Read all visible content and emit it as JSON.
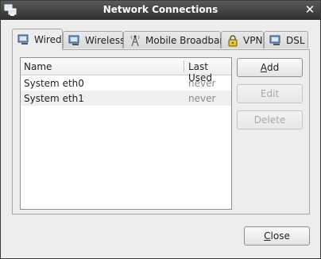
{
  "window": {
    "title": "Network Connections",
    "icon": "network-connections-icon",
    "close_icon": "close-icon"
  },
  "tabs": [
    {
      "label": "Wired",
      "icon": "wired-icon",
      "active": true
    },
    {
      "label": "Wireless",
      "icon": "wireless-icon",
      "active": false
    },
    {
      "label": "Mobile Broadband",
      "icon": "mobile-broadband-icon",
      "active": false
    },
    {
      "label": "VPN",
      "icon": "vpn-lock-icon",
      "active": false
    },
    {
      "label": "DSL",
      "icon": "dsl-icon",
      "active": false
    }
  ],
  "table": {
    "columns": [
      "Name",
      "Last Used"
    ],
    "rows": [
      {
        "name": "System eth0",
        "last_used": "never"
      },
      {
        "name": "System eth1",
        "last_used": "never"
      }
    ]
  },
  "buttons": {
    "add": {
      "mnemonic": "A",
      "rest": "dd",
      "enabled": true
    },
    "edit": {
      "label": "Edit",
      "enabled": false
    },
    "delete": {
      "label": "Delete",
      "enabled": false
    },
    "close": {
      "mnemonic": "C",
      "rest": "lose",
      "enabled": true
    }
  },
  "colors": {
    "titlebar": "#2f2f2f",
    "dialog_bg": "#ededed",
    "last_used_text": "#8a8a8a",
    "alt_row": "#efefef"
  }
}
